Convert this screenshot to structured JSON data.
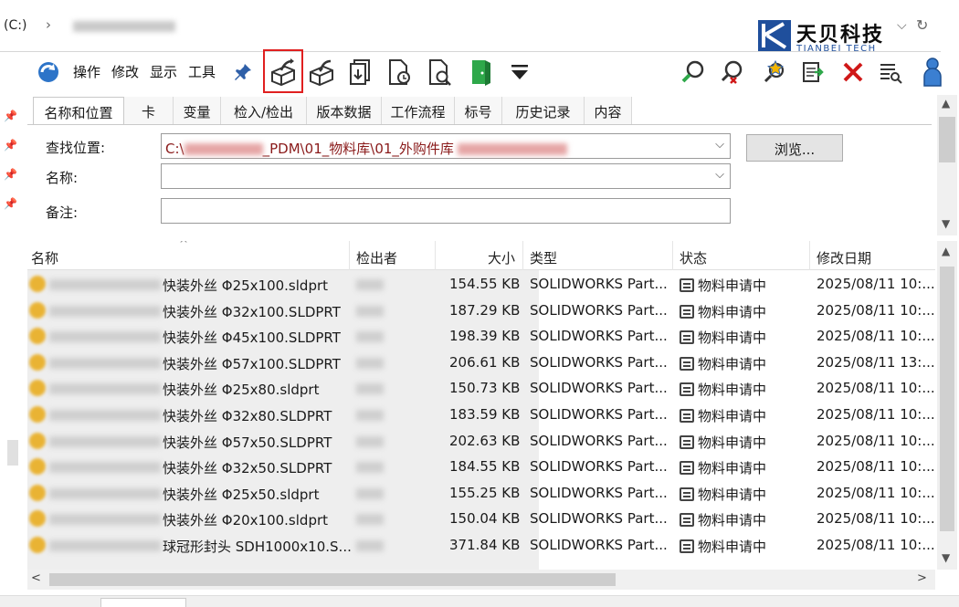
{
  "address": {
    "drive": "(C:)",
    "chevron": "›"
  },
  "logo": {
    "cn": "天贝科技",
    "en": "TIANBEI TECH"
  },
  "toolbar": {
    "menus": [
      "操作",
      "修改",
      "显示",
      "工具"
    ],
    "icons": [
      "refresh-vault-icon",
      "pin-icon",
      "check-out-icon",
      "check-in-icon",
      "get-version-icon",
      "change-state-icon",
      "history-icon",
      "exit-icon",
      "dropdown-arrow-icon",
      "search-icon",
      "clear-search-icon",
      "favorite-search-icon",
      "export-icon",
      "delete-icon",
      "list-view-icon",
      "user-icon"
    ]
  },
  "tabs": [
    "名称和位置",
    "卡",
    "变量",
    "检入/检出",
    "版本数据",
    "工作流程",
    "标号",
    "历史记录",
    "内容"
  ],
  "form": {
    "look_in_label": "查找位置:",
    "look_in_value_a": "C:\\",
    "look_in_value_b": "_PDM\\01_物料库\\01_外购件库",
    "name_label": "名称:",
    "name_value": "",
    "note_label": "备注:",
    "note_value": "",
    "browse": "浏览..."
  },
  "columns": [
    "名称",
    "检出者",
    "大小",
    "类型",
    "状态",
    "修改日期"
  ],
  "rows": [
    {
      "name": "快装外丝 Φ25x100.sldprt",
      "size": "154.55 KB",
      "type": "SOLIDWORKS Part...",
      "status": "物料申请中",
      "date": "2025/08/11 10:..."
    },
    {
      "name": "快装外丝 Φ32x100.SLDPRT",
      "size": "187.29 KB",
      "type": "SOLIDWORKS Part...",
      "status": "物料申请中",
      "date": "2025/08/11 10:..."
    },
    {
      "name": "快装外丝 Φ45x100.SLDPRT",
      "size": "198.39 KB",
      "type": "SOLIDWORKS Part...",
      "status": "物料申请中",
      "date": "2025/08/11 10:..."
    },
    {
      "name": "快装外丝 Φ57x100.SLDPRT",
      "size": "206.61 KB",
      "type": "SOLIDWORKS Part...",
      "status": "物料申请中",
      "date": "2025/08/11 13:..."
    },
    {
      "name": "快装外丝 Φ25x80.sldprt",
      "size": "150.73 KB",
      "type": "SOLIDWORKS Part...",
      "status": "物料申请中",
      "date": "2025/08/11 10:..."
    },
    {
      "name": "快装外丝 Φ32x80.SLDPRT",
      "size": "183.59 KB",
      "type": "SOLIDWORKS Part...",
      "status": "物料申请中",
      "date": "2025/08/11 10:..."
    },
    {
      "name": "快装外丝 Φ57x50.SLDPRT",
      "size": "202.63 KB",
      "type": "SOLIDWORKS Part...",
      "status": "物料申请中",
      "date": "2025/08/11 10:..."
    },
    {
      "name": "快装外丝 Φ32x50.SLDPRT",
      "size": "184.55 KB",
      "type": "SOLIDWORKS Part...",
      "status": "物料申请中",
      "date": "2025/08/11 10:..."
    },
    {
      "name": "快装外丝 Φ25x50.sldprt",
      "size": "155.25 KB",
      "type": "SOLIDWORKS Part...",
      "status": "物料申请中",
      "date": "2025/08/11 10:..."
    },
    {
      "name": "快装外丝 Φ20x100.sldprt",
      "size": "150.04 KB",
      "type": "SOLIDWORKS Part...",
      "status": "物料申请中",
      "date": "2025/08/11 10:..."
    },
    {
      "name": "球冠形封头 SDH1000x10.S...",
      "size": "371.84 KB",
      "type": "SOLIDWORKS Part...",
      "status": "物料申请中",
      "date": "2025/08/11 10:..."
    }
  ],
  "colors": {
    "highlight": "#e02020",
    "logo_blue": "#1f4f9c",
    "path_red": "#8a1a1a",
    "delete_red": "#d01818"
  }
}
